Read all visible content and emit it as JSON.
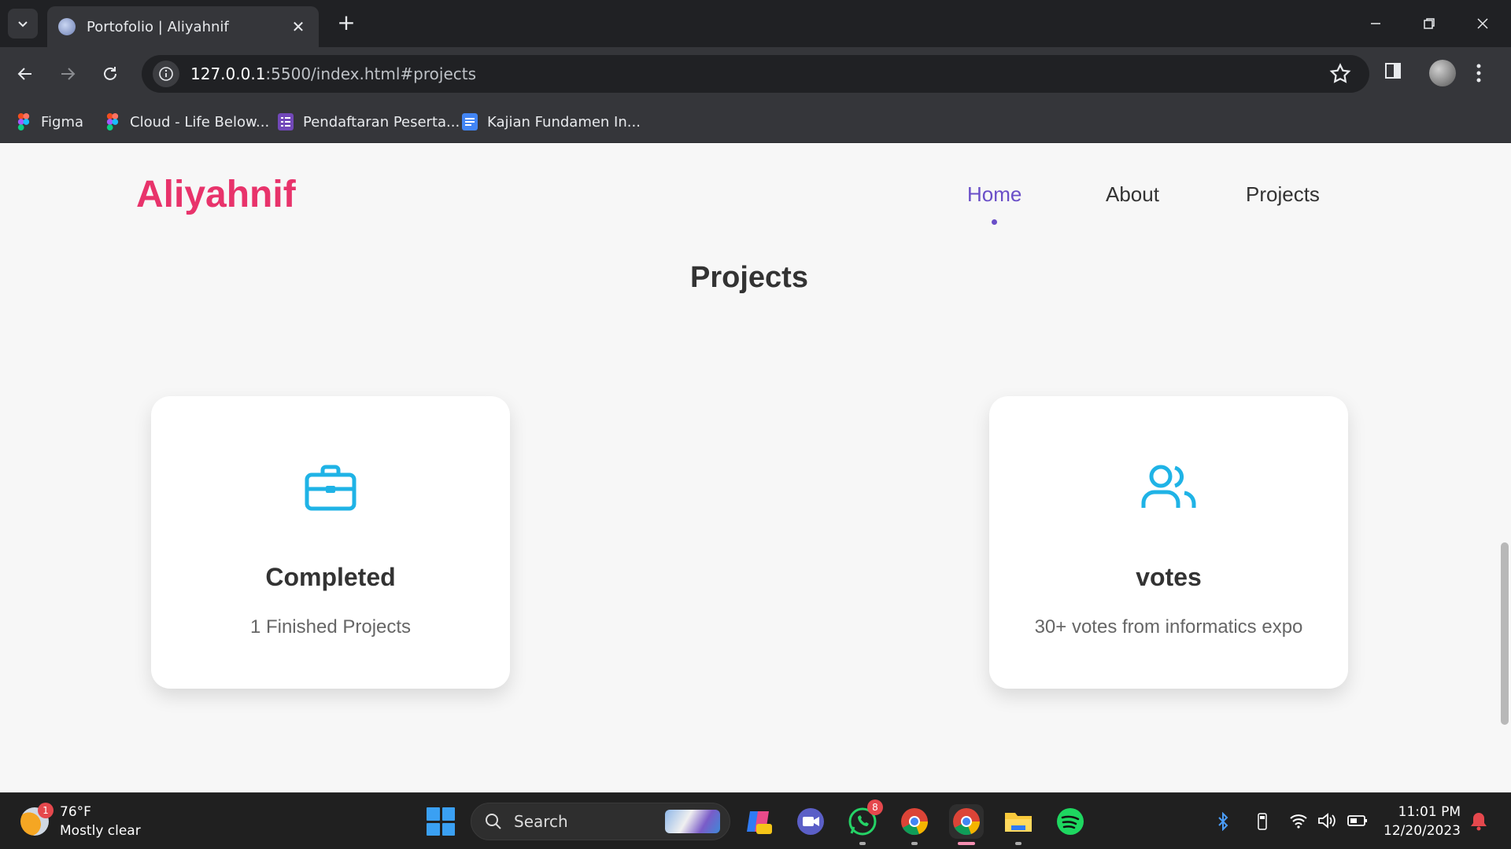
{
  "browser": {
    "tab_title": "Portofolio | Aliyahnif",
    "url_host": "127.0.0.1",
    "url_rest": ":5500/index.html#projects",
    "bookmarks": [
      {
        "label": "Figma",
        "icon": "figma-icon"
      },
      {
        "label": "Cloud - Life Below...",
        "icon": "figma-icon"
      },
      {
        "label": "Pendaftaran Peserta...",
        "icon": "forms-icon"
      },
      {
        "label": "Kajian Fundamen In...",
        "icon": "docs-icon"
      }
    ]
  },
  "site": {
    "logo": "Aliyahnif",
    "nav": [
      {
        "label": "Home",
        "active": true
      },
      {
        "label": "About",
        "active": false
      },
      {
        "label": "Projects",
        "active": false
      }
    ],
    "section_title": "Projects",
    "cards": [
      {
        "icon": "briefcase-icon",
        "title": "Completed",
        "subtitle": "1 Finished Projects"
      },
      {
        "icon": "users-icon",
        "title": "votes",
        "subtitle": "30+ votes from informatics expo"
      }
    ],
    "colors": {
      "logo": "#e8336b",
      "active_nav": "#6a4fc8",
      "card_icon": "#1fb3e6"
    }
  },
  "taskbar": {
    "weather_temp": "76°F",
    "weather_desc": "Mostly clear",
    "weather_badge": "1",
    "search_placeholder": "Search",
    "whatsapp_badge": "8",
    "time": "11:01 PM",
    "date": "12/20/2023"
  }
}
